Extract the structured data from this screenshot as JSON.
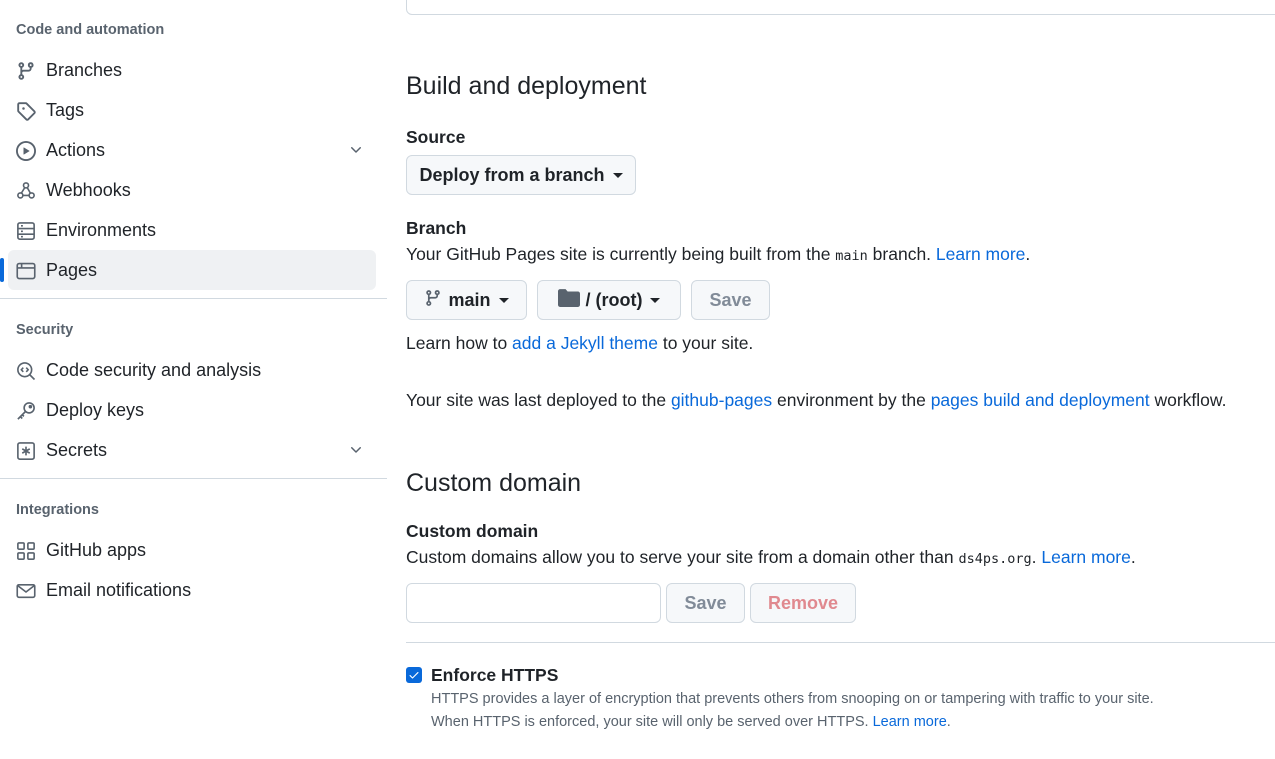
{
  "sidebar": {
    "code_heading": "Code and automation",
    "code_items": [
      {
        "label": "Branches",
        "icon": "branch-icon"
      },
      {
        "label": "Tags",
        "icon": "tag-icon"
      },
      {
        "label": "Actions",
        "icon": "play-icon",
        "expandable": true
      },
      {
        "label": "Webhooks",
        "icon": "webhook-icon"
      },
      {
        "label": "Environments",
        "icon": "server-icon"
      },
      {
        "label": "Pages",
        "icon": "browser-icon",
        "active": true
      }
    ],
    "security_heading": "Security",
    "security_items": [
      {
        "label": "Code security and analysis",
        "icon": "codescan-icon"
      },
      {
        "label": "Deploy keys",
        "icon": "key-icon"
      },
      {
        "label": "Secrets",
        "icon": "asterisk-icon",
        "expandable": true
      }
    ],
    "integrations_heading": "Integrations",
    "integration_items": [
      {
        "label": "GitHub apps",
        "icon": "apps-icon"
      },
      {
        "label": "Email notifications",
        "icon": "mail-icon"
      }
    ]
  },
  "build": {
    "title": "Build and deployment",
    "source_label": "Source",
    "source_value": "Deploy from a branch",
    "branch_label": "Branch",
    "branch_desc_pre": "Your GitHub Pages site is currently being built from the ",
    "branch_desc_code": "main",
    "branch_desc_post": " branch. ",
    "branch_learn_more": "Learn more",
    "branch_desc_end": ".",
    "branch_select": "main",
    "folder_select": "/ (root)",
    "save_label": "Save",
    "jekyll_pre": "Learn how to ",
    "jekyll_link": "add a Jekyll theme",
    "jekyll_post": " to your site.",
    "deploy_pre": "Your site was last deployed to the ",
    "deploy_env_link": "github-pages",
    "deploy_mid": " environment by the ",
    "deploy_workflow_link": "pages build and deployment",
    "deploy_post": " workflow."
  },
  "domain": {
    "title": "Custom domain",
    "label": "Custom domain",
    "desc_pre": "Custom domains allow you to serve your site from a domain other than ",
    "desc_code": "ds4ps.org",
    "desc_post": ". ",
    "learn_more": "Learn more",
    "desc_end": ".",
    "input_value": "",
    "save_label": "Save",
    "remove_label": "Remove"
  },
  "https": {
    "label": "Enforce HTTPS",
    "checked": true,
    "note_line1": "HTTPS provides a layer of encryption that prevents others from snooping on or tampering with traffic to your site.",
    "note_line2_pre": "When HTTPS is enforced, your site will only be served over HTTPS. ",
    "learn_more": "Learn more",
    "note_line2_end": "."
  },
  "colors": {
    "accent": "#0969da",
    "text": "#1f2328",
    "muted": "#59636e",
    "border": "#d1d9e0",
    "active_bg": "#eff1f3"
  }
}
